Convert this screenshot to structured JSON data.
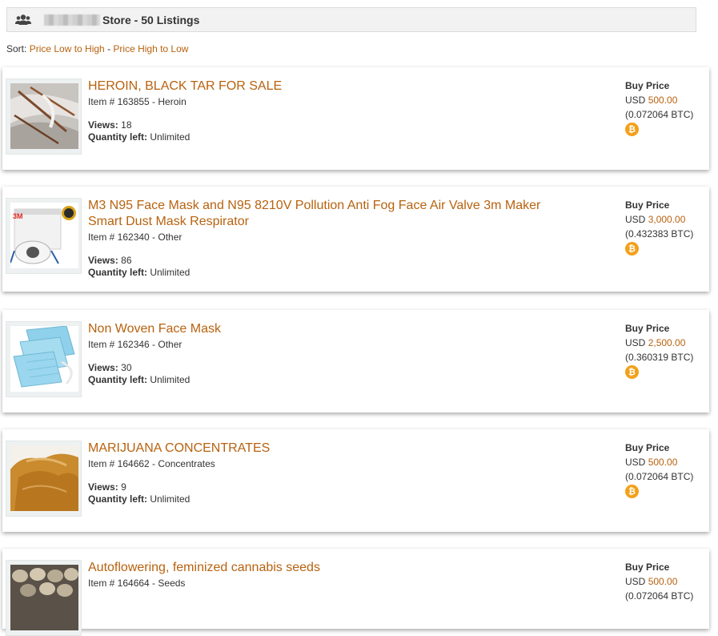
{
  "header": {
    "title": "Store - 50 Listings",
    "icon": "users-icon"
  },
  "sort": {
    "prefix": "Sort: ",
    "option_low": "Price Low to High",
    "separator": " - ",
    "option_high": "Price High to Low"
  },
  "listings": [
    {
      "title": "HEROIN, BLACK TAR FOR SALE",
      "item": "Item # 163855 - Heroin",
      "views_label": "Views:",
      "views": "18",
      "qty_label": "Quantity left:",
      "qty": "Unlimited",
      "price_label": "Buy Price",
      "currency": "USD",
      "amount": "500.00",
      "btc": "(0.072064 BTC)"
    },
    {
      "title": "M3 N95 Face Mask and N95 8210V Pollution Anti Fog Face Air Valve 3m Maker Smart Dust Mask Respirator",
      "item": "Item # 162340 - Other",
      "views_label": "Views:",
      "views": "86",
      "qty_label": "Quantity left:",
      "qty": "Unlimited",
      "price_label": "Buy Price",
      "currency": "USD",
      "amount": "3,000.00",
      "btc": "(0.432383 BTC)"
    },
    {
      "title": "Non Woven Face Mask",
      "item": "Item # 162346 - Other",
      "views_label": "Views:",
      "views": "30",
      "qty_label": "Quantity left:",
      "qty": "Unlimited",
      "price_label": "Buy Price",
      "currency": "USD",
      "amount": "2,500.00",
      "btc": "(0.360319 BTC)"
    },
    {
      "title": "MARIJUANA CONCENTRATES",
      "item": "Item # 164662 - Concentrates",
      "views_label": "Views:",
      "views": "9",
      "qty_label": "Quantity left:",
      "qty": "Unlimited",
      "price_label": "Buy Price",
      "currency": "USD",
      "amount": "500.00",
      "btc": "(0.072064 BTC)"
    },
    {
      "title": "Autoflowering, feminized cannabis seeds",
      "item": "Item # 164664 - Seeds",
      "price_label": "Buy Price",
      "currency": "USD",
      "amount": "500.00",
      "btc": "(0.072064 BTC)"
    }
  ],
  "thumb_label": "3M",
  "btc_glyph": "₿",
  "colors": {
    "accent": "#b8620f",
    "bitcoin": "#f3a01a"
  }
}
